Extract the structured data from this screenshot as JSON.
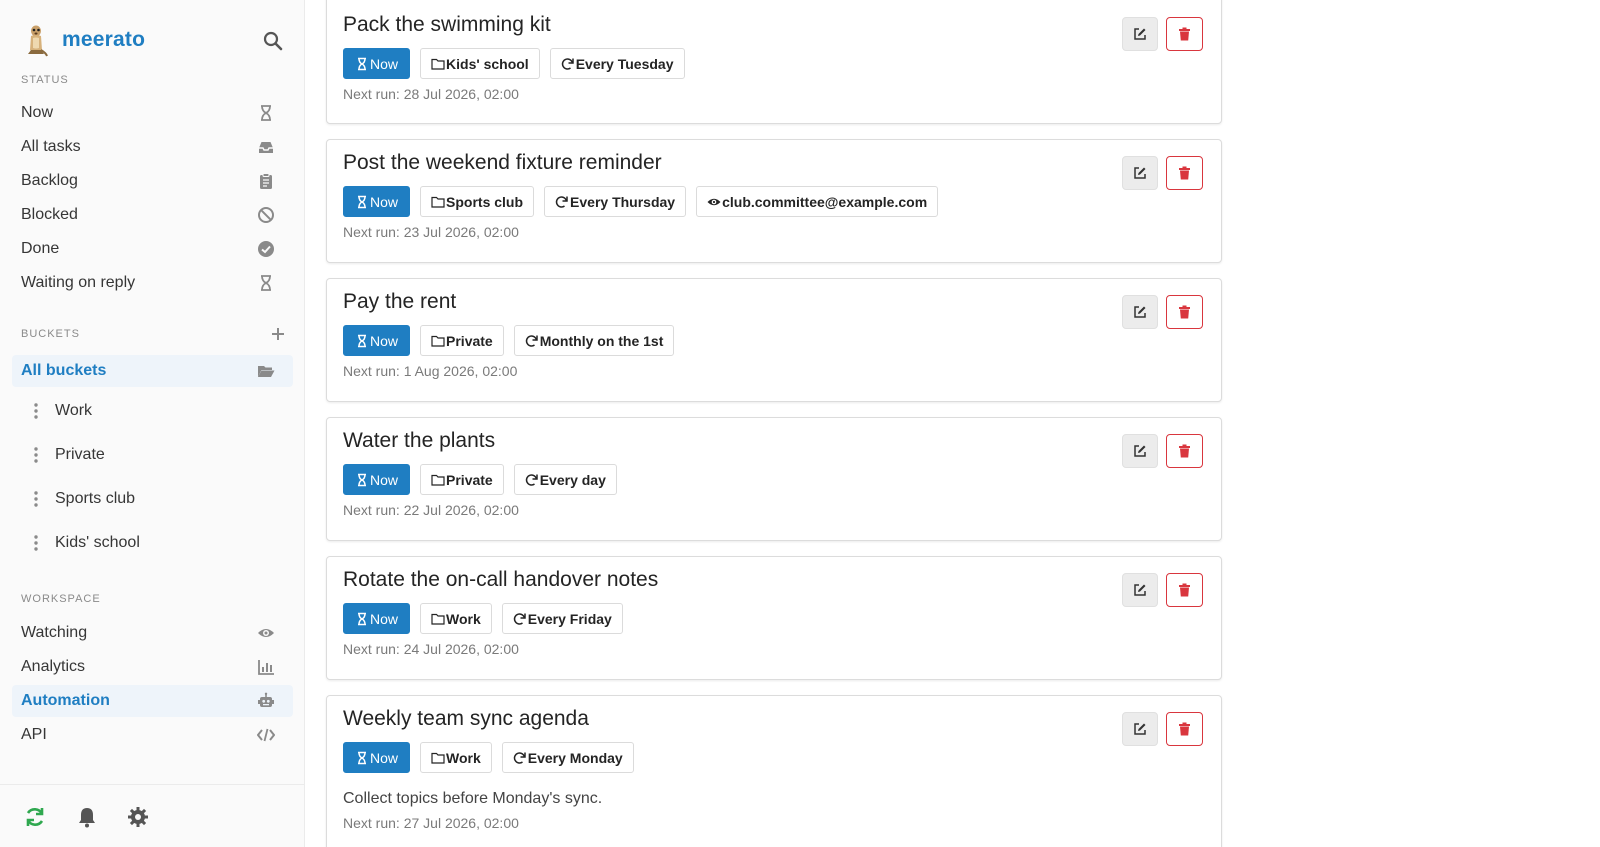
{
  "brand": {
    "name": "meerato"
  },
  "sidebar": {
    "status_label": "STATUS",
    "status_items": [
      {
        "label": "Now",
        "icon": "hourglass-icon"
      },
      {
        "label": "All tasks",
        "icon": "inbox-icon"
      },
      {
        "label": "Backlog",
        "icon": "clipboard-icon"
      },
      {
        "label": "Blocked",
        "icon": "ban-icon"
      },
      {
        "label": "Done",
        "icon": "check-circle-icon"
      },
      {
        "label": "Waiting on reply",
        "icon": "hourglass-icon"
      }
    ],
    "buckets_label": "BUCKETS",
    "all_buckets": "All buckets",
    "buckets": [
      "Work",
      "Private",
      "Sports club",
      "Kids' school"
    ],
    "workspace_label": "WORKSPACE",
    "workspace_items": [
      {
        "label": "Watching",
        "icon": "eye-icon"
      },
      {
        "label": "Analytics",
        "icon": "bar-chart-icon"
      },
      {
        "label": "Automation",
        "icon": "robot-icon",
        "active": true
      },
      {
        "label": "API",
        "icon": "code-icon"
      }
    ]
  },
  "colors": {
    "accent": "#1f7ec2",
    "danger": "#d9363e",
    "sync": "#2fa84f"
  },
  "tasks": [
    {
      "title": "Pack the swimming kit",
      "status": "Now",
      "bucket": "Kids' school",
      "recurrence": "Every Tuesday",
      "watcher": "",
      "description": "",
      "next_run": "Next run: 28 Jul 2026, 02:00"
    },
    {
      "title": "Post the weekend fixture reminder",
      "status": "Now",
      "bucket": "Sports club",
      "recurrence": "Every Thursday",
      "watcher": "club.committee@example.com",
      "description": "",
      "next_run": "Next run: 23 Jul 2026, 02:00"
    },
    {
      "title": "Pay the rent",
      "status": "Now",
      "bucket": "Private",
      "recurrence": "Monthly on the 1st",
      "watcher": "",
      "description": "",
      "next_run": "Next run: 1 Aug 2026, 02:00"
    },
    {
      "title": "Water the plants",
      "status": "Now",
      "bucket": "Private",
      "recurrence": "Every day",
      "watcher": "",
      "description": "",
      "next_run": "Next run: 22 Jul 2026, 02:00"
    },
    {
      "title": "Rotate the on-call handover notes",
      "status": "Now",
      "bucket": "Work",
      "recurrence": "Every Friday",
      "watcher": "",
      "description": "",
      "next_run": "Next run: 24 Jul 2026, 02:00"
    },
    {
      "title": "Weekly team sync agenda",
      "status": "Now",
      "bucket": "Work",
      "recurrence": "Every Monday",
      "watcher": "",
      "description": "Collect topics before Monday's sync.",
      "next_run": "Next run: 27 Jul 2026, 02:00"
    }
  ]
}
